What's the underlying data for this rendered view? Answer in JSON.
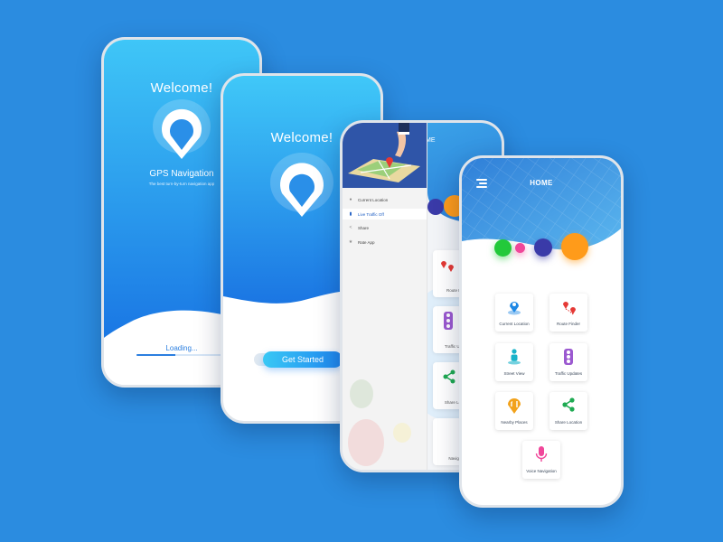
{
  "splash_loading": {
    "welcome": "Welcome!",
    "app_name": "GPS Navigation",
    "tagline": "The best turn-by-turn navigation app",
    "loading_text": "Loading...",
    "progress": 0.45
  },
  "splash_start": {
    "welcome": "Welcome!",
    "button_label": "Get Started"
  },
  "drawer_screen": {
    "header_fragment": "ME",
    "menu_items": [
      {
        "icon": "location-pin-icon",
        "label": "Current Location"
      },
      {
        "icon": "traffic-light-icon",
        "label": "Live Traffic Off"
      },
      {
        "icon": "share-icon",
        "label": "Share"
      },
      {
        "icon": "star-icon",
        "label": "Rate App"
      }
    ],
    "partial_labels": [
      "Route Finder",
      "Traffic Updates",
      "Share Location",
      "Navigation"
    ]
  },
  "home_screen": {
    "title": "HOME",
    "dots": [
      {
        "color": "#22c93a"
      },
      {
        "color": "#f0479a"
      },
      {
        "color": "#3a3aa8"
      },
      {
        "color": "#ff9b1a"
      }
    ],
    "tiles": [
      {
        "icon": "current-location-icon",
        "label": "Current Location"
      },
      {
        "icon": "route-finder-icon",
        "label": "Route Finder"
      },
      {
        "icon": "street-view-icon",
        "label": "Street View"
      },
      {
        "icon": "traffic-updates-icon",
        "label": "Traffic Updates"
      },
      {
        "icon": "nearby-places-icon",
        "label": "Nearby Places"
      },
      {
        "icon": "share-location-icon",
        "label": "Share Location"
      },
      {
        "icon": "voice-navigation-icon",
        "label": "Voice Navigation"
      }
    ]
  },
  "colors": {
    "background": "#2b8ce0",
    "accent_blue": "#1f86f0",
    "light_blue": "#39c8f5"
  }
}
